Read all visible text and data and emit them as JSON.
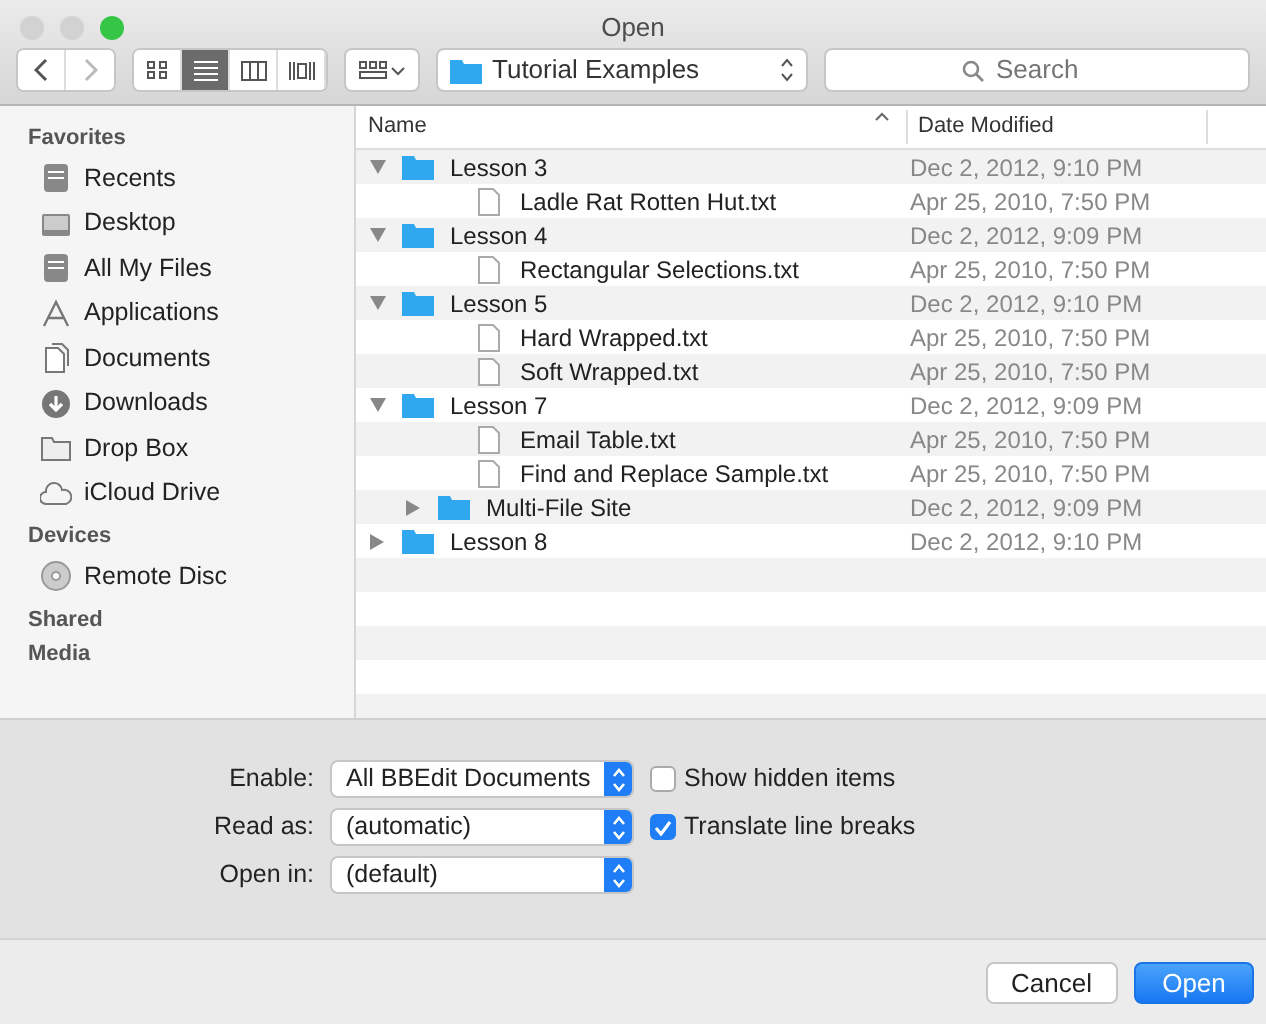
{
  "window": {
    "title": "Open"
  },
  "toolbar": {
    "view_modes": [
      {
        "selected": false
      },
      {
        "selected": true
      },
      {
        "selected": false
      },
      {
        "selected": false
      }
    ],
    "location": "Tutorial Examples",
    "search": {
      "placeholder": "Search"
    }
  },
  "sidebar": {
    "sections": [
      {
        "title": "Favorites",
        "items": [
          {
            "label": "Recents",
            "kind": "recents"
          },
          {
            "label": "Desktop",
            "kind": "desktop"
          },
          {
            "label": "All My Files",
            "kind": "recents"
          },
          {
            "label": "Applications",
            "kind": "apps"
          },
          {
            "label": "Documents",
            "kind": "docs"
          },
          {
            "label": "Downloads",
            "kind": "downloads"
          },
          {
            "label": "Drop Box",
            "kind": "folder"
          },
          {
            "label": "iCloud Drive",
            "kind": "cloud"
          }
        ]
      },
      {
        "title": "Devices",
        "items": [
          {
            "label": "Remote Disc",
            "kind": "disc"
          }
        ]
      },
      {
        "title": "Shared"
      },
      {
        "title": "Media"
      }
    ]
  },
  "file_list": {
    "columns": [
      "Name",
      "Date Modified"
    ],
    "rows": [
      {
        "name": "Lesson 3",
        "date": "Dec 2, 2012, 9:10 PM",
        "kind": "folder",
        "expanded": true,
        "children": [
          {
            "name": "Ladle Rat Rotten Hut.txt",
            "date": "Apr 25, 2010, 7:50 PM",
            "kind": "file"
          }
        ]
      },
      {
        "name": "Lesson 4",
        "date": "Dec 2, 2012, 9:09 PM",
        "kind": "folder",
        "expanded": true,
        "children": [
          {
            "name": "Rectangular Selections.txt",
            "date": "Apr 25, 2010, 7:50 PM",
            "kind": "file"
          }
        ]
      },
      {
        "name": "Lesson 5",
        "date": "Dec 2, 2012, 9:10 PM",
        "kind": "folder",
        "expanded": true,
        "children": [
          {
            "name": "Hard Wrapped.txt",
            "date": "Apr 25, 2010, 7:50 PM",
            "kind": "file"
          },
          {
            "name": "Soft Wrapped.txt",
            "date": "Apr 25, 2010, 7:50 PM",
            "kind": "file"
          }
        ]
      },
      {
        "name": "Lesson 7",
        "date": "Dec 2, 2012, 9:09 PM",
        "kind": "folder",
        "expanded": true,
        "children": [
          {
            "name": "Email Table.txt",
            "date": "Apr 25, 2010, 7:50 PM",
            "kind": "file"
          },
          {
            "name": "Find and Replace Sample.txt",
            "date": "Apr 25, 2010, 7:50 PM",
            "kind": "file"
          },
          {
            "name": "Multi-File Site",
            "date": "Dec 2, 2012, 9:09 PM",
            "kind": "folder",
            "expanded": false
          }
        ]
      },
      {
        "name": "Lesson 8",
        "date": "Dec 2, 2012, 9:10 PM",
        "kind": "folder",
        "expanded": false
      }
    ]
  },
  "options": [
    {
      "label": "Enable:",
      "value": "All BBEdit Documents",
      "checkbox": {
        "label": "Show hidden items",
        "checked": false
      }
    },
    {
      "label": "Read as:",
      "value": "(automatic)",
      "checkbox": {
        "label": "Translate line breaks",
        "checked": true
      }
    },
    {
      "label": "Open in:",
      "value": "(default)"
    }
  ],
  "buttons": [
    {
      "label": "Cancel",
      "kind": "secondary"
    },
    {
      "label": "Open",
      "kind": "primary"
    }
  ]
}
